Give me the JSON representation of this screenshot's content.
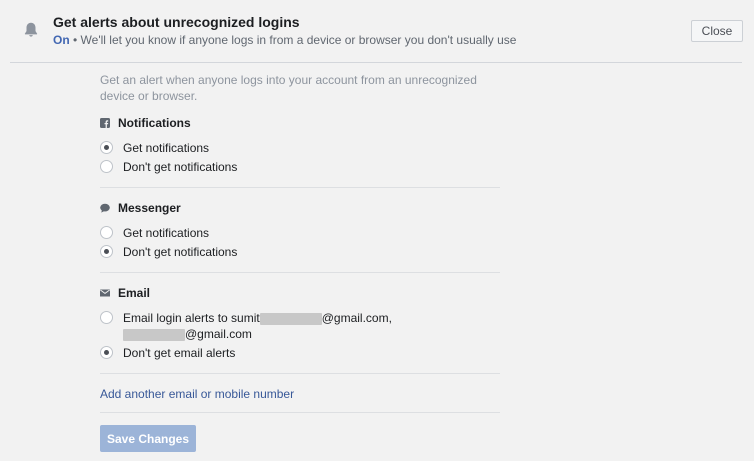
{
  "header": {
    "title": "Get alerts about unrecognized logins",
    "status": "On",
    "separator": " • ",
    "subtitle": "We'll let you know if anyone logs in from a device or browser you don't usually use",
    "close_label": "Close",
    "bell_icon": "bell-icon"
  },
  "main": {
    "description": "Get an alert when anyone logs into your account from an unrecognized device or browser.",
    "sections": [
      {
        "title": "Notifications",
        "icon": "facebook-icon",
        "options": [
          {
            "label": "Get notifications",
            "selected": true
          },
          {
            "label": "Don't get notifications",
            "selected": false
          }
        ]
      },
      {
        "title": "Messenger",
        "icon": "chat-bubble-icon",
        "options": [
          {
            "label": "Get notifications",
            "selected": false
          },
          {
            "label": "Don't get notifications",
            "selected": true
          }
        ]
      },
      {
        "title": "Email",
        "icon": "envelope-icon",
        "options": [
          {
            "label_prefix": "Email login alerts to sumit",
            "label_mid": "@gmail.com,",
            "label_end": "@gmail.com",
            "selected": false
          },
          {
            "label": "Don't get email alerts",
            "selected": true
          }
        ]
      }
    ],
    "add_link": "Add another email or mobile number",
    "save_label": "Save Changes"
  },
  "colors": {
    "background": "#f2f2f2",
    "accent": "#4267b2",
    "link": "#385898",
    "save_disabled": "#9cb4d8"
  }
}
